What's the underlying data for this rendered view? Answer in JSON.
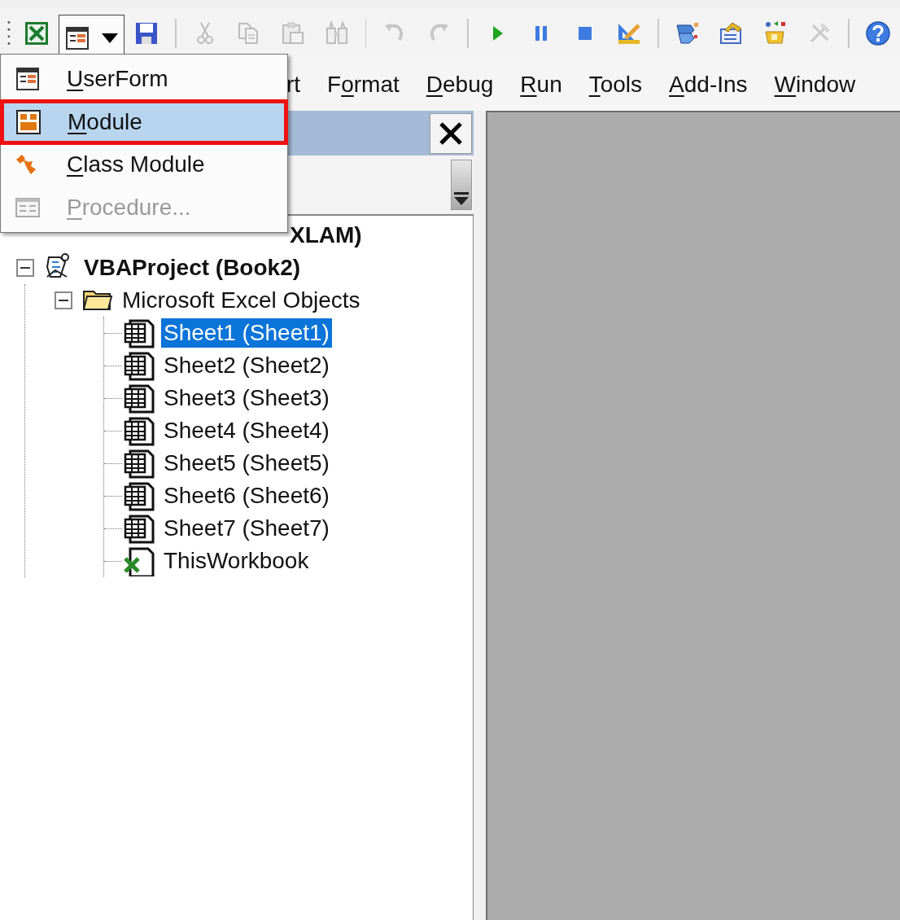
{
  "toolbar": [
    {
      "kind": "grip"
    },
    {
      "kind": "excel",
      "disabled": false
    },
    {
      "kind": "insert-userform",
      "disabled": false,
      "pressed": true
    },
    {
      "kind": "save",
      "disabled": false
    },
    {
      "kind": "separator"
    },
    {
      "kind": "cut",
      "disabled": true
    },
    {
      "kind": "copy",
      "disabled": true
    },
    {
      "kind": "paste",
      "disabled": true
    },
    {
      "kind": "find",
      "disabled": true
    },
    {
      "kind": "separator"
    },
    {
      "kind": "undo",
      "disabled": true
    },
    {
      "kind": "redo",
      "disabled": true
    },
    {
      "kind": "separator"
    },
    {
      "kind": "run",
      "disabled": false
    },
    {
      "kind": "pause",
      "disabled": false
    },
    {
      "kind": "stop",
      "disabled": false
    },
    {
      "kind": "design",
      "disabled": false
    },
    {
      "kind": "separator"
    },
    {
      "kind": "explorer",
      "disabled": false
    },
    {
      "kind": "properties",
      "disabled": false
    },
    {
      "kind": "browser",
      "disabled": false
    },
    {
      "kind": "toolbox",
      "disabled": true
    },
    {
      "kind": "separator"
    },
    {
      "kind": "help",
      "disabled": false
    }
  ],
  "menu_bar": [
    {
      "pre": "rt"
    },
    {
      "pre": "F",
      "key": "o",
      "post": "rmat"
    },
    {
      "key": "D",
      "post": "ebug"
    },
    {
      "key": "R",
      "post": "un"
    },
    {
      "key": "T",
      "post": "ools"
    },
    {
      "key": "A",
      "post": "dd-Ins"
    },
    {
      "key": "W",
      "post": "indow"
    }
  ],
  "insert_menu": [
    {
      "kind": "userform",
      "key": "U",
      "post": "serForm",
      "selected": false,
      "disabled": false
    },
    {
      "kind": "module",
      "key": "M",
      "post": "odule",
      "selected": true,
      "disabled": false
    },
    {
      "kind": "class",
      "key": "C",
      "post": "lass Module",
      "selected": false,
      "disabled": false
    },
    {
      "kind": "procedure",
      "key": "P",
      "post": "rocedure...",
      "selected": false,
      "disabled": true
    }
  ],
  "project_tree": [
    {
      "kind": "project",
      "label": "XLAM)",
      "clipped": true,
      "selected": false
    },
    {
      "kind": "project",
      "label": "VBAProject (Book2)",
      "clipped": false,
      "expanded": true,
      "selected": false,
      "children": [
        {
          "kind": "folder",
          "label": "Microsoft Excel Objects",
          "clipped": false,
          "expanded": true,
          "selected": false,
          "children": [
            {
              "kind": "sheet",
              "label": "Sheet1 (Sheet1)",
              "selected": true
            },
            {
              "kind": "sheet",
              "label": "Sheet2 (Sheet2)",
              "selected": false
            },
            {
              "kind": "sheet",
              "label": "Sheet3 (Sheet3)",
              "selected": false
            },
            {
              "kind": "sheet",
              "label": "Sheet4 (Sheet4)",
              "selected": false
            },
            {
              "kind": "sheet",
              "label": "Sheet5 (Sheet5)",
              "selected": false
            },
            {
              "kind": "sheet",
              "label": "Sheet6 (Sheet6)",
              "selected": false
            },
            {
              "kind": "sheet",
              "label": "Sheet7 (Sheet7)",
              "selected": false
            },
            {
              "kind": "workbook",
              "label": "ThisWorkbook",
              "selected": false
            }
          ]
        }
      ]
    }
  ]
}
